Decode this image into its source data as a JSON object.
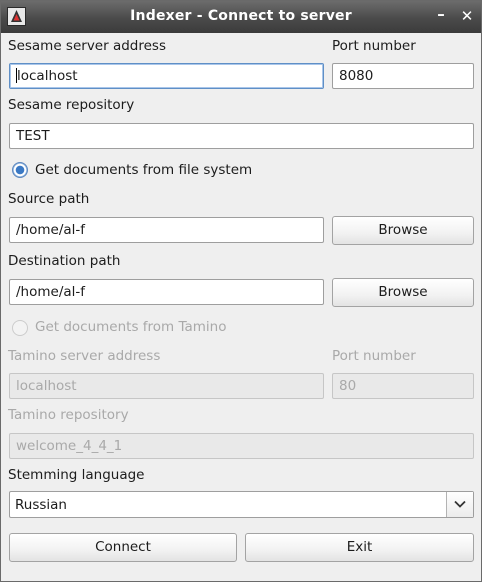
{
  "window": {
    "title": "Indexer - Connect to server",
    "minimize_glyph": "–",
    "close_glyph": "✕",
    "icon": "app-icon"
  },
  "sesame": {
    "server_label": "Sesame server address",
    "server_value": "localhost",
    "port_label": "Port number",
    "port_value": "8080",
    "repo_label": "Sesame repository",
    "repo_value": "TEST"
  },
  "source_radio": {
    "label": "Get documents from file system",
    "checked": true
  },
  "filesystem": {
    "source_label": "Source path",
    "source_value": "/home/al-f",
    "source_browse": "Browse",
    "dest_label": "Destination path",
    "dest_value": "/home/al-f",
    "dest_browse": "Browse"
  },
  "tamino_radio": {
    "label": "Get documents from Tamino",
    "checked": false,
    "enabled": false
  },
  "tamino": {
    "server_label": "Tamino server address",
    "server_value": "localhost",
    "port_label": "Port number",
    "port_value": "80",
    "repo_label": "Tamino repository",
    "repo_value": "welcome_4_4_1"
  },
  "stemming": {
    "label": "Stemming language",
    "selected": "Russian"
  },
  "actions": {
    "connect": "Connect",
    "exit": "Exit"
  }
}
